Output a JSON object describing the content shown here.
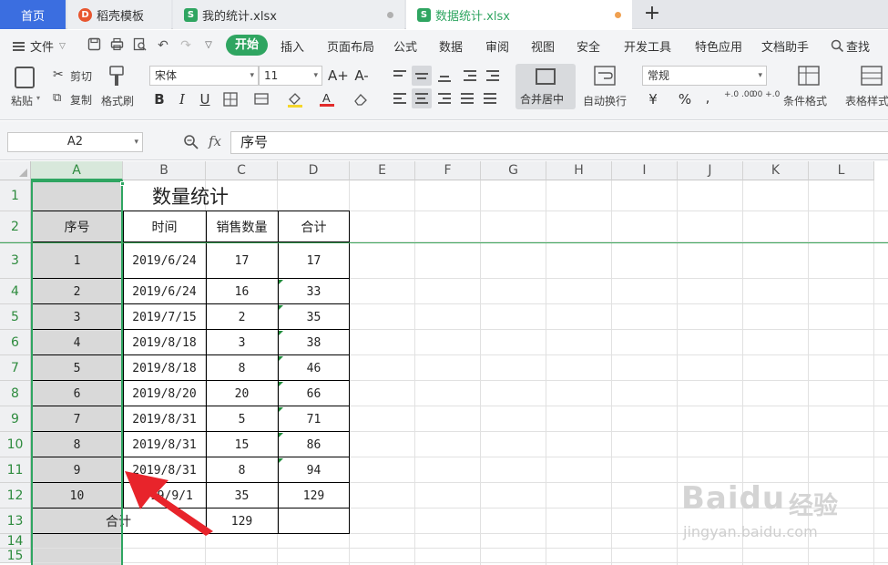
{
  "tabs": {
    "home": "首页",
    "templates": "稻壳模板",
    "my_stats": "我的统计.xlsx",
    "current": "数据统计.xlsx",
    "new_tab": "+",
    "current_dot_color": "#f0a050",
    "other_dot_color": "#b0b0b0"
  },
  "menu": {
    "file": "文件",
    "start": "开始",
    "items": [
      "插入",
      "页面布局",
      "公式",
      "数据",
      "审阅",
      "视图",
      "安全",
      "开发工具",
      "特色应用",
      "文档助手"
    ],
    "search": "查找"
  },
  "ribbon": {
    "paste": "粘贴",
    "cut": "剪切",
    "copy": "复制",
    "format_painter": "格式刷",
    "font_name": "宋体",
    "font_size": "11",
    "grow_font": "A+",
    "shrink_font": "A-",
    "bold": "B",
    "italic": "I",
    "underline": "U",
    "merge_center": "合并居中",
    "wrap_text": "自动换行",
    "number_format": "常规",
    "currency": "¥",
    "percent": "%",
    "thousands": ",",
    "inc_decimal": "+.0 .00",
    "dec_decimal": ".00 +.0",
    "conditional_format": "条件格式",
    "table_style": "表格样式"
  },
  "formula_bar": {
    "name_box": "A2",
    "fx": "fx",
    "content": "序号"
  },
  "grid": {
    "columns": [
      "A",
      "B",
      "C",
      "D",
      "E",
      "F",
      "G",
      "H",
      "I",
      "J",
      "K",
      "L"
    ],
    "active_column": "A",
    "rows": [
      "1",
      "2",
      "3",
      "4",
      "5",
      "6",
      "7",
      "8",
      "9",
      "10",
      "11",
      "12",
      "13",
      "14",
      "15"
    ]
  },
  "sheet": {
    "title": "数量统计",
    "headers": [
      "序号",
      "时间",
      "销售数量",
      "合计"
    ],
    "data": [
      [
        "1",
        "2019/6/24",
        "17",
        "17"
      ],
      [
        "2",
        "2019/6/24",
        "16",
        "33"
      ],
      [
        "3",
        "2019/7/15",
        "2",
        "35"
      ],
      [
        "4",
        "2019/8/18",
        "3",
        "38"
      ],
      [
        "5",
        "2019/8/18",
        "8",
        "46"
      ],
      [
        "6",
        "2019/8/20",
        "20",
        "66"
      ],
      [
        "7",
        "2019/8/31",
        "5",
        "71"
      ],
      [
        "8",
        "2019/8/31",
        "15",
        "86"
      ],
      [
        "9",
        "2019/8/31",
        "8",
        "94"
      ],
      [
        "10",
        "2019/9/1",
        "35",
        "129"
      ]
    ],
    "total_label": "合计",
    "total_qty": "129"
  },
  "watermark": {
    "logo": "Baidu",
    "cn": "经验",
    "url": "jingyan.baidu.com"
  },
  "colors": {
    "accent_green": "#2fa561",
    "home_tab_blue": "#3b6ee0",
    "arrow_red": "#e8242b"
  }
}
